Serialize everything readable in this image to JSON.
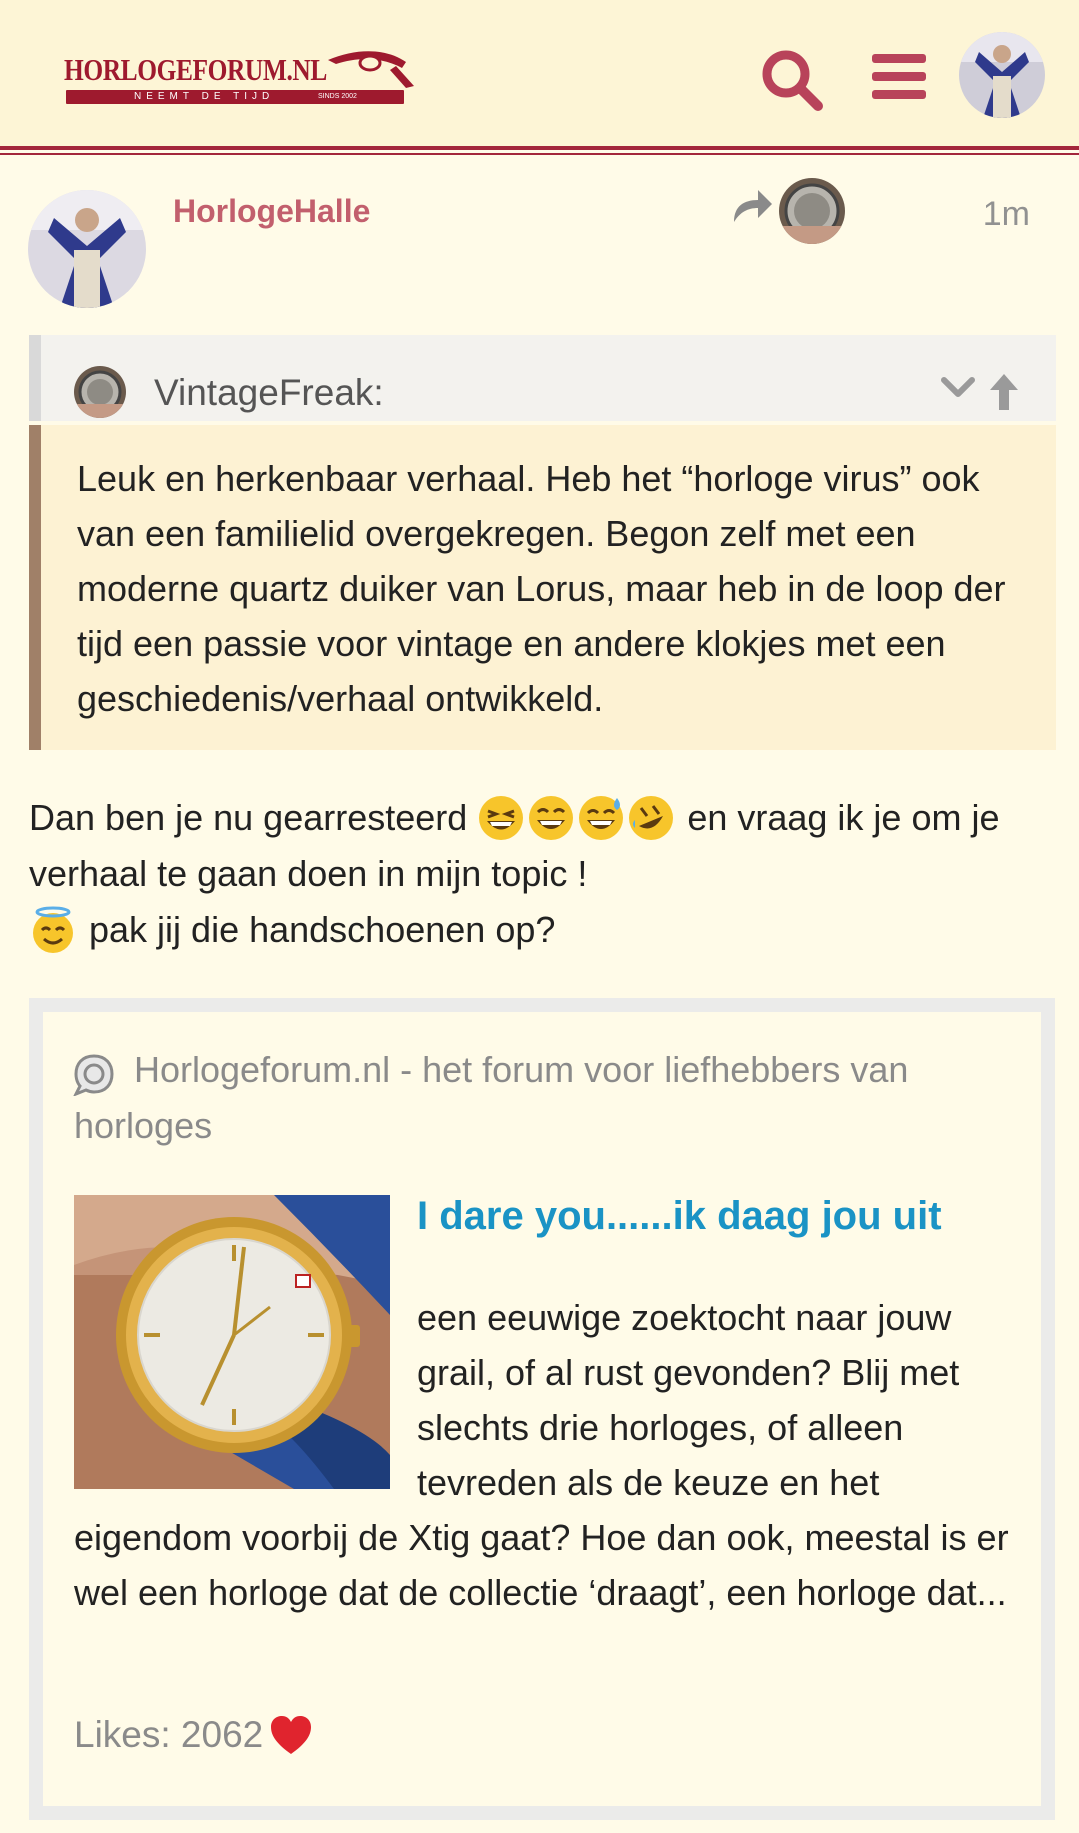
{
  "header": {
    "logo_text": "HORLOGEFORUM.NL",
    "logo_tagline": "NEEMT DE TIJD",
    "logo_since": "SINDS 2002",
    "brand_color": "#9e1a2e",
    "icons": [
      "search-icon",
      "hamburger-menu-icon",
      "user-avatar"
    ]
  },
  "post": {
    "username": "HorlogeHalle",
    "time": "1m",
    "reply_icon": "reply-arrow-icon",
    "quote": {
      "username": "VintageFreak:",
      "text": "Leuk en herkenbaar verhaal. Heb het “horloge virus” ook van een familielid overgekregen. Begon zelf met een moderne quartz duiker van Lorus, maar heb in de loop der tijd een passie voor vintage en andere klokjes met een geschiedenis/verhaal ontwikkeld."
    },
    "body_line1": "Dan ben je nu gearresteerd",
    "body_line1_rest": "en vraag ik je om je verhaal te gaan doen in mijn topic !",
    "body_line2": "pak jij die handschoenen op?",
    "emojis": [
      "grinning-squinting-face",
      "laughing-face",
      "grinning-face-with-sweat",
      "rolling-on-floor-laughing",
      "smiling-face-with-halo"
    ]
  },
  "onebox": {
    "site": "Horlogeforum.nl - het forum voor liefhebbers van horloges",
    "title": "I dare you......ik daag jou uit",
    "excerpt": "een eeuwige zoektocht naar jouw grail, of al rust gevonden? Blij met slechts drie horloges, of alleen tevreden als de keuze en het eigendom voorbij de Xtig gaat? Hoe dan ook, meestal is er wel een horloge dat de collectie ‘draagt’, een horloge dat...",
    "likes": "Likes: 2062",
    "link_color": "#1a93c5"
  }
}
